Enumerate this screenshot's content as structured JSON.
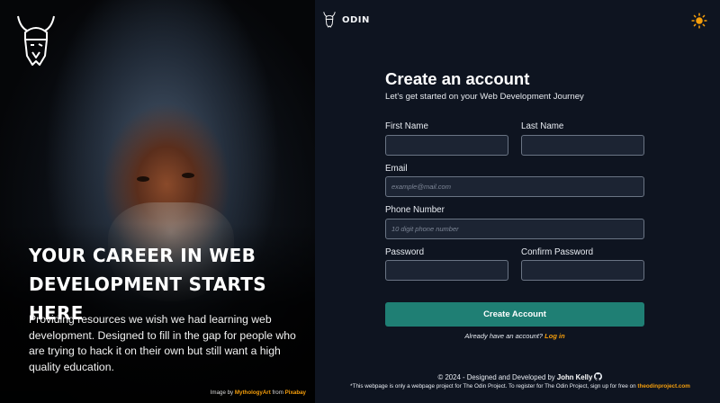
{
  "hero": {
    "logo_icon": "odin-viking-helmet-icon",
    "title": "Your career in web development starts here",
    "text": "Providing resources we wish we had learning web development. Designed to fill in the gap for people who are trying to hack it on their own but still want a high quality education.",
    "credit_prefix": "Image by",
    "credit_author": "MythologyArt",
    "credit_mid": "from",
    "credit_site": "Pixabay"
  },
  "brand": {
    "logo_icon": "odin-viking-helmet-icon",
    "name": "ODIN"
  },
  "theme_toggle_icon": "sun-icon",
  "form": {
    "title": "Create an account",
    "subtitle": "Let's get started on your Web Development Journey",
    "first_name_label": "First Name",
    "last_name_label": "Last Name",
    "email_label": "Email",
    "email_placeholder": "example@mail.com",
    "phone_label": "Phone Number",
    "phone_placeholder": "10 digit phone number",
    "password_label": "Password",
    "confirm_password_label": "Confirm Password",
    "submit_label": "Create Account",
    "have_account_text": "Already have an account?",
    "login_link": "Log in"
  },
  "footer": {
    "copyright": "© 2024 - Designed and Developed by",
    "author": "John Kelly",
    "github_icon": "github-icon",
    "note": "*This webpage is only a webpage project for The Odin Project. To register for The Odin Project, sign up for free on",
    "note_link": "theodinproject.com"
  },
  "colors": {
    "background": "#0e1420",
    "accent": "#1f7f74",
    "link": "#f59e0b",
    "field_bg": "#1c2433"
  }
}
